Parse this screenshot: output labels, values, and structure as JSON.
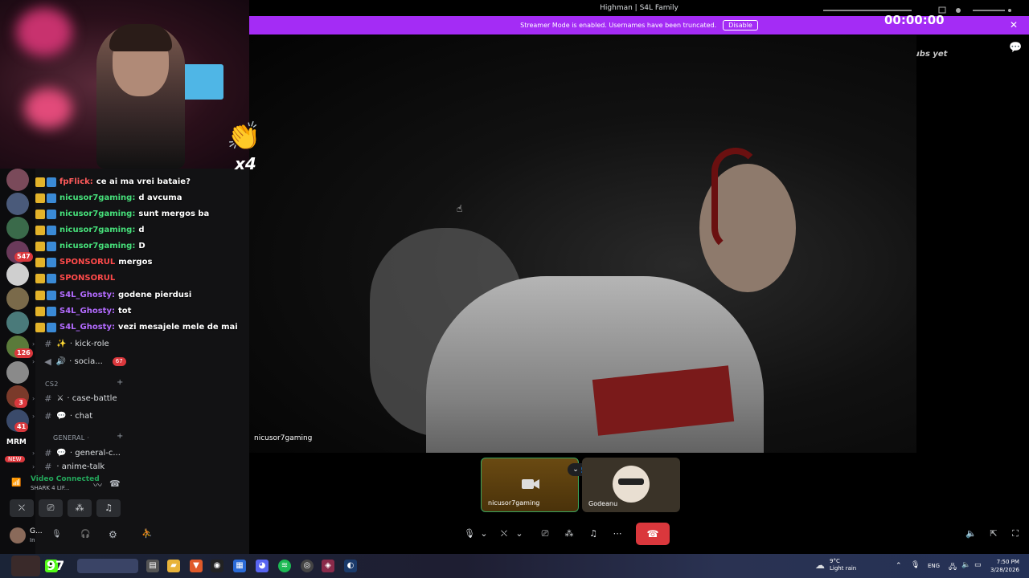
{
  "window": {
    "title": "Highman | S4L Family"
  },
  "streamer_bar": {
    "message": "Streamer Mode is enabled. Usernames have been truncated.",
    "disable_label": "Disable"
  },
  "stream_overlay": {
    "timer": "00:00:00",
    "subs": "No subs yet",
    "clap_count": "x4"
  },
  "chat": [
    {
      "user": "fpFlick:",
      "msg": "ce ai ma vrei bataie?",
      "color": "#ff5b5b"
    },
    {
      "user": "nicusor7gaming:",
      "msg": "d avcuma",
      "color": "#46e07a"
    },
    {
      "user": "nicusor7gaming:",
      "msg": "sunt mergos ba",
      "color": "#46e07a"
    },
    {
      "user": "nicusor7gaming:",
      "msg": "d",
      "color": "#46e07a"
    },
    {
      "user": "nicusor7gaming:",
      "msg": "D",
      "color": "#46e07a"
    },
    {
      "user": "SPONSORUL",
      "msg": "mergos",
      "color": "#ff4a4a"
    },
    {
      "user": "SPONSORUL",
      "msg": "",
      "color": "#ff4a4a"
    },
    {
      "user": "S4L_Ghosty:",
      "msg": "godene pierdusi",
      "color": "#b36bff"
    },
    {
      "user": "S4L_Ghosty:",
      "msg": "tot",
      "color": "#b36bff"
    },
    {
      "user": "S4L_Ghosty:",
      "msg": "vezi mesajele mele de mai",
      "color": "#b36bff"
    }
  ],
  "server_badges": [
    "547",
    "126",
    "3",
    "41"
  ],
  "server_text": {
    "mrm": "MRM",
    "new": "NEW"
  },
  "channels": {
    "items": [
      {
        "name": "· kick-role",
        "emoji": "✨"
      },
      {
        "name": "· socia...",
        "emoji": "🔊",
        "badge": "67"
      },
      {
        "name": "· case-battle",
        "emoji": "⚔"
      },
      {
        "name": "· chat",
        "emoji": "💬"
      },
      {
        "name": "· general-c...",
        "emoji": "💬"
      },
      {
        "name": "· anime-talk",
        "emoji": ""
      }
    ],
    "categories": [
      "CS2",
      "GENERAL ·"
    ]
  },
  "voice": {
    "status": "Video Connected",
    "channel": "SHARK 4 LIF...",
    "user": "G...",
    "user_status": "In"
  },
  "video": {
    "main_label": "nicusor7gaming"
  },
  "participants": [
    {
      "name": "nicusor7gaming"
    },
    {
      "name": "Godeanu"
    }
  ],
  "taskbar": {
    "score": "97",
    "weather_temp": "9°C",
    "weather_desc": "Light rain",
    "lang": "ENG",
    "time": "7:50 PM",
    "date": "3/28/2026"
  }
}
